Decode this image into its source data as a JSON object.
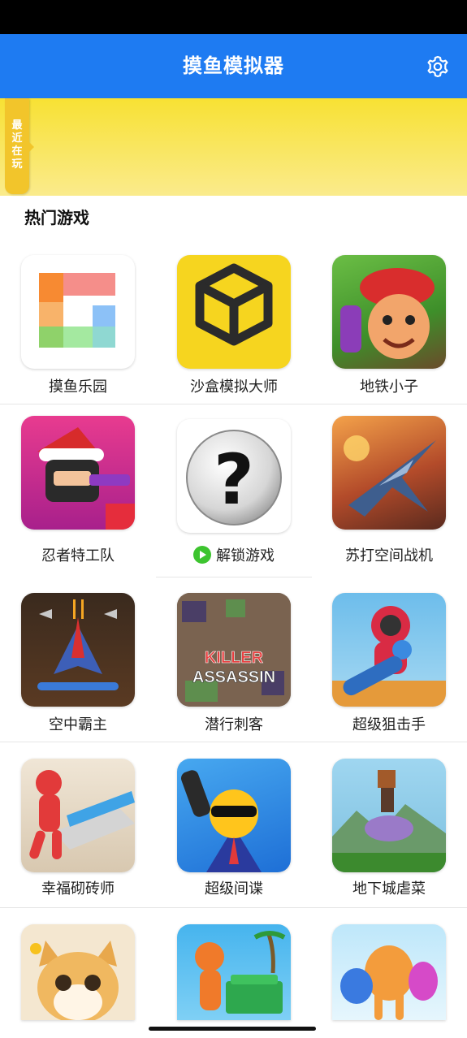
{
  "header": {
    "title": "摸鱼模拟器"
  },
  "recent_tab": {
    "label": "最\n近\n在\n玩"
  },
  "section": {
    "title": "热门游戏"
  },
  "games": [
    {
      "name": "摸鱼乐园",
      "icon": "grid-logo-icon"
    },
    {
      "name": "沙盒模拟大师",
      "icon": "sandbox-cube-icon"
    },
    {
      "name": "地铁小子",
      "icon": "subway-boy-icon"
    },
    {
      "name": "忍者特工队",
      "icon": "ninja-agent-icon"
    },
    {
      "name": "解锁游戏",
      "icon": "question-mark-icon",
      "locked": true
    },
    {
      "name": "苏打空间战机",
      "icon": "fighter-jet-icon"
    },
    {
      "name": "空中霸主",
      "icon": "sky-fighter-icon"
    },
    {
      "name": "潜行刺客",
      "icon": "killer-assassin-icon",
      "icon_text": [
        "KILLER",
        "ASSASSIN"
      ]
    },
    {
      "name": "超级狙击手",
      "icon": "super-sniper-icon"
    },
    {
      "name": "幸福砌砖师",
      "icon": "brick-builder-icon"
    },
    {
      "name": "超级间谍",
      "icon": "super-spy-icon"
    },
    {
      "name": "地下城虐菜",
      "icon": "dungeon-pixel-icon"
    },
    {
      "name": "",
      "icon": "shiba-dog-icon"
    },
    {
      "name": "",
      "icon": "money-runner-icon"
    },
    {
      "name": "",
      "icon": "color-blobs-icon"
    }
  ],
  "colors": {
    "header": "#1E7BF2",
    "banner": "#F8E133",
    "unlock": "#3DC42F"
  }
}
